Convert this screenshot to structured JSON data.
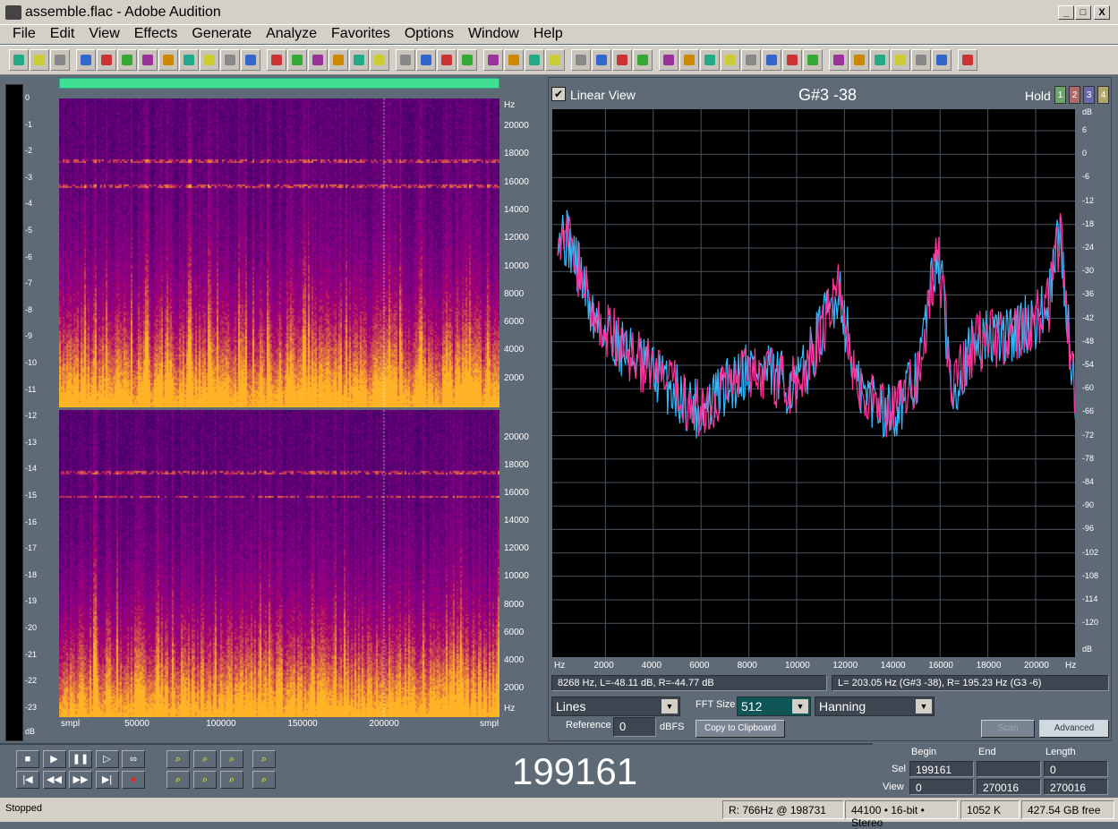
{
  "window": {
    "title": "assemble.flac - Adobe Audition",
    "minimize": "_",
    "maximize": "□",
    "close": "X"
  },
  "menu": [
    "File",
    "Edit",
    "View",
    "Effects",
    "Generate",
    "Analyze",
    "Favorites",
    "Options",
    "Window",
    "Help"
  ],
  "meter": {
    "ticks": [
      "0",
      "-1",
      "-2",
      "-3",
      "-4",
      "-5",
      "-6",
      "-7",
      "-8",
      "-9",
      "-10",
      "-11",
      "-12",
      "-13",
      "-14",
      "-15",
      "-16",
      "-17",
      "-18",
      "-19",
      "-20",
      "-21",
      "-22",
      "-23"
    ],
    "unit": "dB"
  },
  "spectrogram": {
    "freq_ticks": [
      "Hz",
      "20000",
      "18000",
      "16000",
      "14000",
      "12000",
      "10000",
      "8000",
      "6000",
      "4000",
      "2000"
    ],
    "bottom_unit": "Hz",
    "x_ticks": [
      "smpl",
      "50000",
      "100000",
      "150000",
      "200000",
      "smpl"
    ],
    "cursor_sample": 199161
  },
  "analysis": {
    "linear_view_label": "Linear View",
    "linear_view_checked": true,
    "note": "G#3 -38",
    "hold_label": "Hold",
    "hold_buttons": [
      {
        "label": "1",
        "color": "#6aa86a"
      },
      {
        "label": "2",
        "color": "#b06868"
      },
      {
        "label": "3",
        "color": "#6868b0"
      },
      {
        "label": "4",
        "color": "#b0a868"
      }
    ],
    "db_ticks": [
      "dB",
      "6",
      "0",
      "-6",
      "-12",
      "-18",
      "-24",
      "-30",
      "-36",
      "-42",
      "-48",
      "-54",
      "-60",
      "-66",
      "-72",
      "-78",
      "-84",
      "-90",
      "-96",
      "-102",
      "-108",
      "-114",
      "-120",
      "dB"
    ],
    "freq_ticks": [
      "Hz",
      "2000",
      "4000",
      "6000",
      "8000",
      "10000",
      "12000",
      "14000",
      "16000",
      "18000",
      "20000",
      "Hz"
    ],
    "cursor_readout": "8268 Hz, L=-48.11 dB, R=-44.77 dB",
    "peak_readout": "L= 203.05 Hz (G#3 -38), R= 195.23 Hz (G3 -6)",
    "display_mode": "Lines",
    "fft_label": "FFT Size",
    "fft_size": "512",
    "window_fn": "Hanning",
    "reference_label": "Reference",
    "reference_value": "0",
    "reference_unit": "dBFS",
    "copy_button": "Copy to Clipboard",
    "scan_button": "Scan",
    "advanced_button": "Advanced",
    "colors": {
      "left": "#ff3399",
      "right": "#33bbff"
    }
  },
  "transport": {
    "time": "199161"
  },
  "selection": {
    "begin_label": "Begin",
    "end_label": "End",
    "length_label": "Length",
    "sel_label": "Sel",
    "view_label": "View",
    "sel_begin": "199161",
    "sel_end": "",
    "sel_length": "0",
    "view_begin": "0",
    "view_end": "270016",
    "view_length": "270016"
  },
  "status": {
    "state": "Stopped",
    "cursor": "R: 766Hz @ 198731",
    "format": "44100 • 16-bit • Stereo",
    "size": "1052 K",
    "free": "427.54 GB free"
  }
}
